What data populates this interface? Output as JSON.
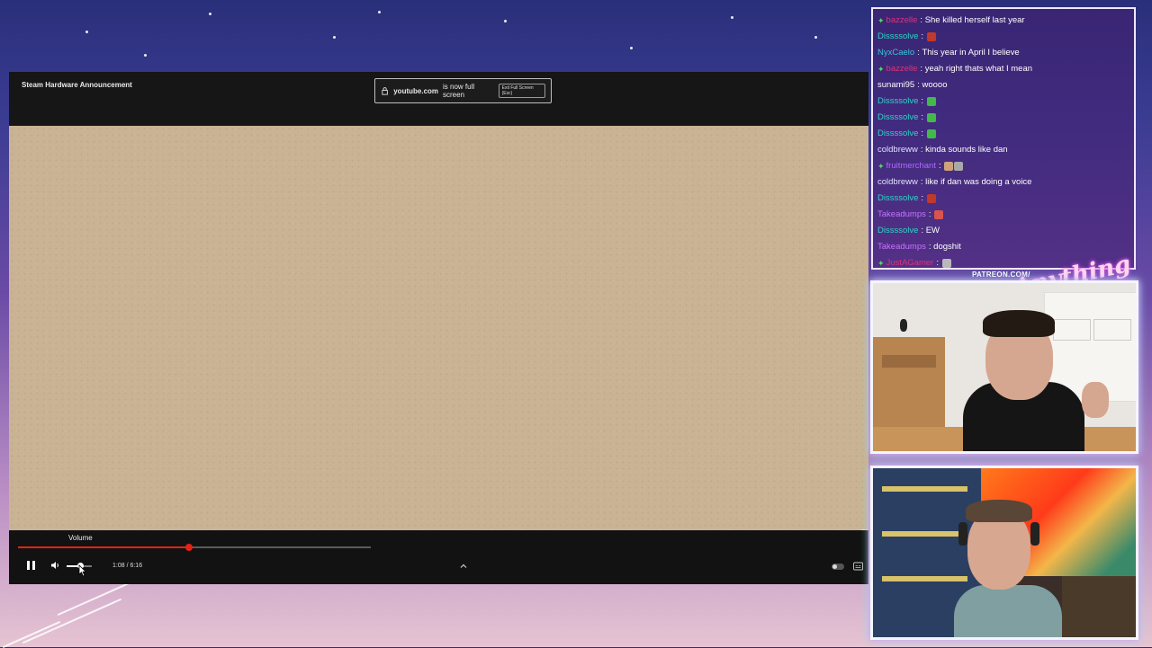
{
  "player": {
    "video_title": "Steam Hardware Announcement",
    "fullscreen_notice": {
      "domain": "youtube.com",
      "message": "is now full screen",
      "exit_label": "Exit Full Screen (Esc)"
    },
    "tooltip": "Volume",
    "time": "1:08 / 6:16",
    "progress_fraction": 0.484,
    "volume_fraction": 0.55
  },
  "chat": {
    "messages": [
      {
        "user": "bazzelle",
        "text": "She killed herself last year",
        "color": "#e0327a",
        "badge": true
      },
      {
        "user": "Dissssolve",
        "text": "",
        "color": "#2bd6c6",
        "badge": false,
        "emotes": [
          "#c0392b"
        ]
      },
      {
        "user": "NyxCaelo",
        "text": "This year in April I believe",
        "color": "#38c3d8",
        "badge": false
      },
      {
        "user": "bazzelle",
        "text": "yeah right thats what I mean",
        "color": "#e0327a",
        "badge": true
      },
      {
        "user": "sunami95",
        "text": "woooo",
        "color": "#ffffff",
        "badge": false
      },
      {
        "user": "Dissssolve",
        "text": "",
        "color": "#2bd6c6",
        "badge": false,
        "emotes": [
          "#43b94b"
        ]
      },
      {
        "user": "Dissssolve",
        "text": "",
        "color": "#2bd6c6",
        "badge": false,
        "emotes": [
          "#43b94b"
        ]
      },
      {
        "user": "Dissssolve",
        "text": "",
        "color": "#2bd6c6",
        "badge": false,
        "emotes": [
          "#43b94b"
        ]
      },
      {
        "user": "coldbreww",
        "text": "kinda sounds like dan",
        "color": "#e0e0ff",
        "badge": false
      },
      {
        "user": "fruitmerchant",
        "text": "",
        "color": "#b267ff",
        "badge": true,
        "emotes": [
          "#cfa37a",
          "#a9a9a9"
        ]
      },
      {
        "user": "coldbreww",
        "text": "like if dan was doing a voice",
        "color": "#e0e0ff",
        "badge": false
      },
      {
        "user": "Dissssolve",
        "text": "",
        "color": "#2bd6c6",
        "badge": false,
        "emotes": [
          "#c0392b"
        ]
      },
      {
        "user": "Takeadumps",
        "text": "",
        "color": "#c872ff",
        "badge": false,
        "emotes": [
          "#d9534f"
        ]
      },
      {
        "user": "Dissssolve",
        "text": "EW",
        "color": "#2bd6c6",
        "badge": false
      },
      {
        "user": "Takeadumps",
        "text": "dogshit",
        "color": "#c872ff",
        "badge": false
      },
      {
        "user": "JustAGamer",
        "text": "",
        "color": "#e0327a",
        "badge": true,
        "emotes": [
          "#b9b9b9"
        ]
      }
    ]
  },
  "branding": {
    "url": "PATREON.COM/",
    "logo_text": "Anything Else?"
  },
  "colors": {
    "accent_red": "#e62117",
    "cam_border": "#f2f6ff"
  }
}
